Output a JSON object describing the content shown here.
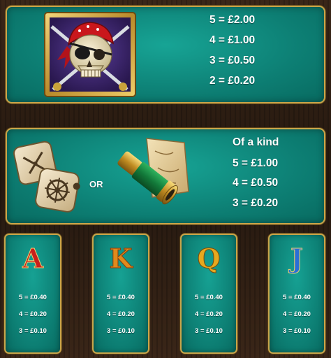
{
  "symbols": {
    "skull": {
      "icon": "pirate-skull-icon",
      "payouts": [
        "5 = £2.00",
        "4 = £1.00",
        "3 = £0.50",
        "2 = £0.20"
      ]
    },
    "dice_telescope": {
      "icons": [
        "dice-icon",
        "telescope-map-icon"
      ],
      "or_label": "OR",
      "header": "Of a kind",
      "payouts": [
        "5 = £1.00",
        "4 = £0.50",
        "3 = £0.20"
      ]
    },
    "cards": [
      {
        "letter": "A",
        "color": "#c8201c",
        "payouts": [
          "5 = £0.40",
          "4 = £0.20",
          "3 = £0.10"
        ]
      },
      {
        "letter": "K",
        "color": "#e08a1c",
        "payouts": [
          "5 = £0.40",
          "4 = £0.20",
          "3 = £0.10"
        ]
      },
      {
        "letter": "Q",
        "color": "#e6a81e",
        "payouts": [
          "5 = £0.40",
          "4 = £0.20",
          "3 = £0.10"
        ]
      },
      {
        "letter": "J",
        "color": "#2a6fd6",
        "payouts": [
          "5 = £0.40",
          "4 = £0.20",
          "3 = £0.10"
        ]
      }
    ]
  },
  "colors": {
    "panel": "#0d7f74",
    "border_gold": "#c9a54a",
    "background_wood": "#2a1c12"
  }
}
